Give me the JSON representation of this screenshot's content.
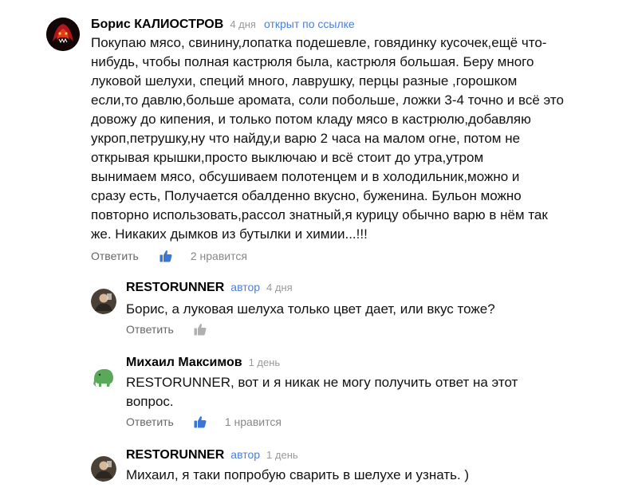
{
  "comments": [
    {
      "author": "Борис КАЛИОСТРОВ",
      "time": "4 дня",
      "link": "открыт по ссылке",
      "text_lines": [
        "Покупаю мясо, свинину,лопатка подешевле, говядинку кусочек,ещё что-",
        "нибудь, чтобы полная кастрюля была, кастрюля большая. Беру много",
        "луковой шелухи, специй много, лаврушку, перцы разные ,горошком",
        "если,то давлю,больше аромата, соли побольше, ложки 3-4 точно и всё это",
        "довожу до кипения, и только потом кладу мясо в кастрюлю,добавляю",
        "укроп,петрушку,ну что найду,и варю 2 часа на малом огне, потом не",
        "открывая крышки,просто выключаю и всё стоит до утра,утром",
        "вынимаем мясо, обсушиваем полотенцем и в холодильник,можно и",
        "сразу есть, Получается обалденно вкусно, буженина. Бульон можно",
        "повторно использовать,рассол знатный,я курицу обычно варю в нём так",
        "же. Никаких дымков из бутылки и химии...!!!"
      ],
      "reply_label": "Ответить",
      "likes": "2 нравится",
      "avatar_icon": "fire-creature-avatar-icon"
    },
    {
      "author": "RESTORUNNER",
      "tag": "автор",
      "time": "4 дня",
      "text_lines": [
        "Борис, а луковая шелуха только цвет дает, или вкус тоже?"
      ],
      "reply_label": "Ответить",
      "avatar_icon": "person-photo-avatar-icon"
    },
    {
      "author": "Михаил Максимов",
      "time": "1 день",
      "text_lines": [
        "RESTORUNNER, вот и я никак не могу получить ответ на этот",
        "вопрос."
      ],
      "reply_label": "Ответить",
      "likes": "1 нравится",
      "avatar_icon": "elephant-avatar-icon"
    },
    {
      "author": "RESTORUNNER",
      "tag": "автор",
      "time": "1 день",
      "text_lines": [
        "Михаил, я таки попробую сварить в шелухе и узнать. )"
      ],
      "avatar_icon": "person-photo-avatar-icon"
    }
  ],
  "colors": {
    "link": "#4d7fd6",
    "like_active": "#3b76d6",
    "like_inactive": "#b0b0b0",
    "muted": "#999999"
  }
}
